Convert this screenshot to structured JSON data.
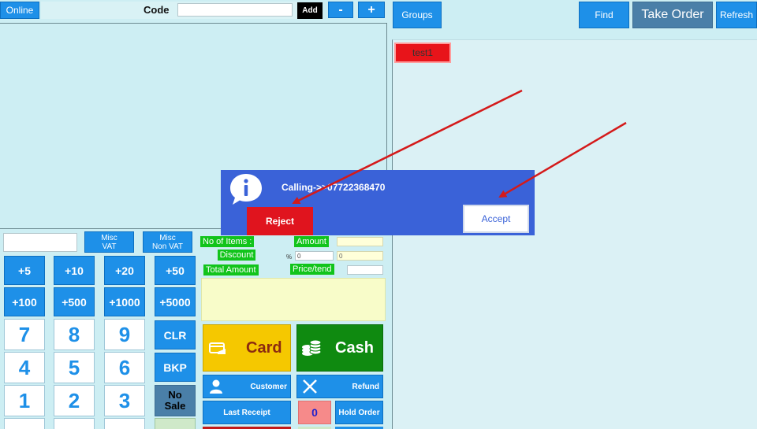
{
  "topbar": {
    "online_label": "Online",
    "code_label": "Code",
    "code_value": "",
    "add_label": "Add",
    "minus_label": "-",
    "plus_label": "+"
  },
  "right_top": {
    "groups_label": "Groups",
    "find_label": "Find",
    "take_order_label": "Take Order",
    "refresh_label": "Refresh"
  },
  "groups": [
    {
      "label": "test1"
    }
  ],
  "misc": {
    "input_value": "",
    "misc_vat_label": "Misc\nVAT",
    "misc_nonvat_label": "Misc\nNon VAT"
  },
  "keypad": {
    "quick": [
      "+5",
      "+10",
      "+20",
      "+50",
      "+100",
      "+500",
      "+1000",
      "+5000"
    ],
    "digits": [
      "7",
      "8",
      "9",
      "4",
      "5",
      "6",
      "1",
      "2",
      "3"
    ],
    "clr_label": "CLR",
    "bkp_label": "BKP",
    "nosale_label": "No\nSale"
  },
  "totals": {
    "items_label": "No of Items :",
    "amount_label": "Amount",
    "discount_label": "Discount",
    "pct_label": "%",
    "discount_pct_value": "0",
    "discount_amount_value": "0",
    "total_label": "Total Amount",
    "price_tend_label": "Price/tend"
  },
  "payment": {
    "card_label": "Card",
    "cash_label": "Cash",
    "customer_label": "Customer",
    "refund_label": "Refund",
    "last_receipt_label": "Last Receipt",
    "count_value": "0",
    "hold_order_label": "Hold Order"
  },
  "dialog": {
    "message": "Calling->>07722368470",
    "reject_label": "Reject",
    "accept_label": "Accept",
    "colors": {
      "background": "#3a62d8",
      "reject": "#e0141e",
      "accept_text": "#3a62d8"
    }
  },
  "colors": {
    "accent_blue": "#1e90e8",
    "green": "#11c41b",
    "card_yellow": "#f5c800",
    "cash_green": "#0f8a10",
    "take_order_bg": "#4a7fa8",
    "arrow_red": "#d41a1a"
  }
}
